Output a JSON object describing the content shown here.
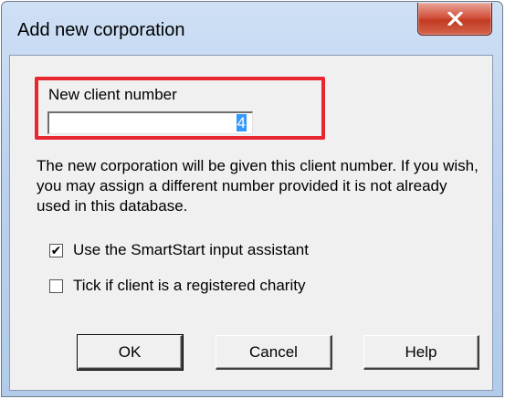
{
  "window": {
    "title": "Add new corporation"
  },
  "field": {
    "label": "New client number",
    "value": "4"
  },
  "description": "The new corporation will be given this client number. If you wish, you may assign a different number provided it is not already used in this database.",
  "options": [
    {
      "label": "Use the SmartStart input assistant",
      "checked": true,
      "check_glyph": "✔"
    },
    {
      "label": "Tick if client is a registered charity",
      "checked": false,
      "check_glyph": ""
    }
  ],
  "buttons": {
    "ok": "OK",
    "cancel": "Cancel",
    "help": "Help"
  },
  "colors": {
    "highlight": "#e8262f",
    "selection": "#3399ff",
    "close_button": "#c23a22"
  },
  "icons": {
    "close": "close-icon"
  }
}
